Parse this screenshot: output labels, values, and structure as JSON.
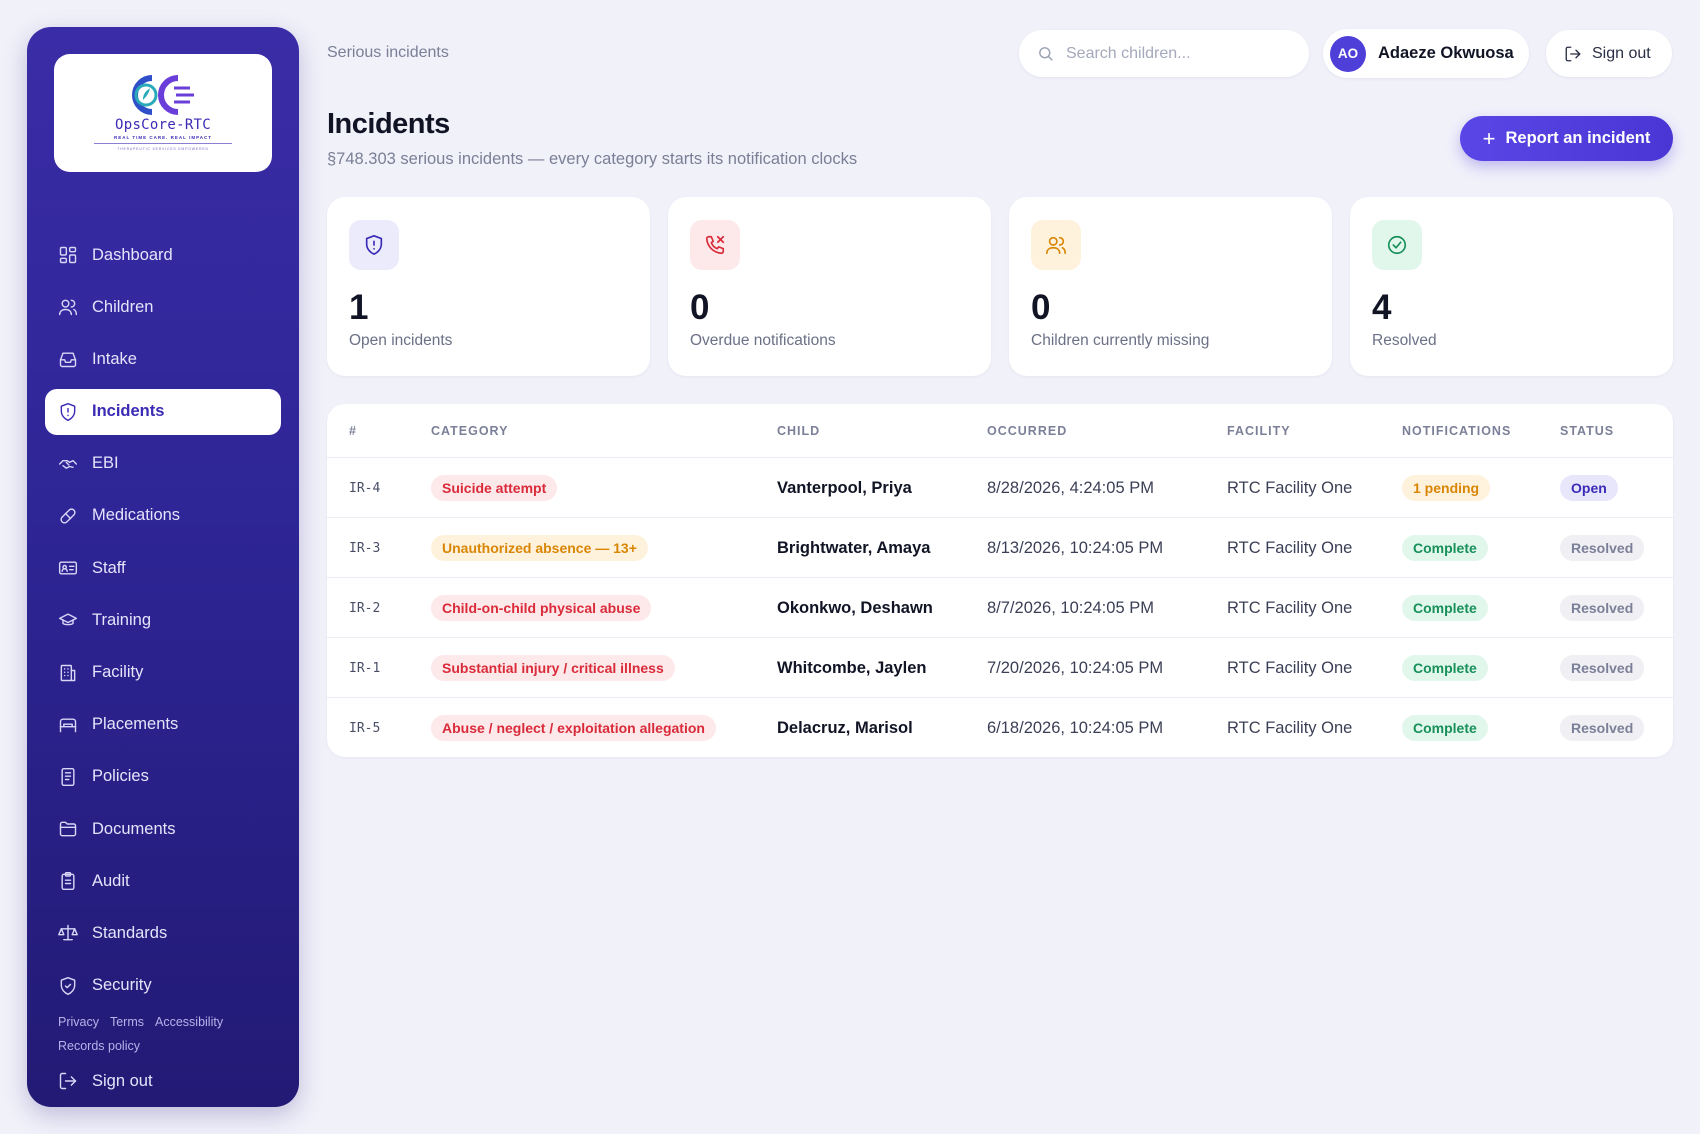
{
  "brand": {
    "name": "OpsCore-RTC",
    "tagline": "REAL TIME CARE. REAL IMPACT",
    "footline": "THERAPEUTIC SERVICES EMPOWERED"
  },
  "sidebar": {
    "items": [
      {
        "label": "Dashboard",
        "icon": "dashboard-icon"
      },
      {
        "label": "Children",
        "icon": "children-icon"
      },
      {
        "label": "Intake",
        "icon": "inbox-icon"
      },
      {
        "label": "Incidents",
        "icon": "shield-alert-icon",
        "active": true
      },
      {
        "label": "EBI",
        "icon": "handshake-icon"
      },
      {
        "label": "Medications",
        "icon": "pill-icon"
      },
      {
        "label": "Staff",
        "icon": "id-card-icon"
      },
      {
        "label": "Training",
        "icon": "graduation-cap-icon"
      },
      {
        "label": "Facility",
        "icon": "building-icon"
      },
      {
        "label": "Placements",
        "icon": "bed-icon"
      },
      {
        "label": "Policies",
        "icon": "document-icon"
      },
      {
        "label": "Documents",
        "icon": "folder-icon"
      },
      {
        "label": "Audit",
        "icon": "clipboard-icon"
      },
      {
        "label": "Standards",
        "icon": "scale-icon"
      },
      {
        "label": "Security",
        "icon": "shield-check-icon"
      }
    ],
    "footer_links": [
      "Privacy",
      "Terms",
      "Accessibility",
      "Records policy"
    ],
    "signout_label": "Sign out"
  },
  "header": {
    "breadcrumb": "Serious incidents",
    "search_placeholder": "Search children...",
    "user_initials": "AO",
    "user_name": "Adaeze Okwuosa",
    "signout_label": "Sign out"
  },
  "page": {
    "title": "Incidents",
    "subtitle": "§748.303 serious incidents — every category starts its notification clocks",
    "report_button": "Report an incident"
  },
  "stats": [
    {
      "value": "1",
      "label": "Open incidents",
      "icon": "shield-alert-icon",
      "bg": "#ecebfb",
      "color": "#3b2bb5"
    },
    {
      "value": "0",
      "label": "Overdue notifications",
      "icon": "phone-alert-icon",
      "bg": "#fde8ea",
      "color": "#d92b3a"
    },
    {
      "value": "0",
      "label": "Children currently missing",
      "icon": "people-icon",
      "bg": "#fff2dc",
      "color": "#d98606"
    },
    {
      "value": "4",
      "label": "Resolved",
      "icon": "check-circle-icon",
      "bg": "#e2f7ec",
      "color": "#17905a"
    }
  ],
  "table": {
    "columns": [
      "#",
      "CATEGORY",
      "CHILD",
      "OCCURRED",
      "FACILITY",
      "NOTIFICATIONS",
      "STATUS"
    ],
    "rows": [
      {
        "id": "IR-4",
        "category": "Suicide attempt",
        "category_tone": "red",
        "child": "Vanterpool, Priya",
        "occurred": "8/28/2026, 4:24:05 PM",
        "facility": "RTC Facility One",
        "notifications": "1 pending",
        "notifications_tone": "amber",
        "status": "Open",
        "status_tone": "indigo"
      },
      {
        "id": "IR-3",
        "category": "Unauthorized absence — 13+",
        "category_tone": "amber",
        "child": "Brightwater, Amaya",
        "occurred": "8/13/2026, 10:24:05 PM",
        "facility": "RTC Facility One",
        "notifications": "Complete",
        "notifications_tone": "green",
        "status": "Resolved",
        "status_tone": "gray"
      },
      {
        "id": "IR-2",
        "category": "Child-on-child physical abuse",
        "category_tone": "red",
        "child": "Okonkwo, Deshawn",
        "occurred": "8/7/2026, 10:24:05 PM",
        "facility": "RTC Facility One",
        "notifications": "Complete",
        "notifications_tone": "green",
        "status": "Resolved",
        "status_tone": "gray"
      },
      {
        "id": "IR-1",
        "category": "Substantial injury / critical illness",
        "category_tone": "red",
        "child": "Whitcombe, Jaylen",
        "occurred": "7/20/2026, 10:24:05 PM",
        "facility": "RTC Facility One",
        "notifications": "Complete",
        "notifications_tone": "green",
        "status": "Resolved",
        "status_tone": "gray"
      },
      {
        "id": "IR-5",
        "category": "Abuse / neglect / exploitation allegation",
        "category_tone": "red",
        "child": "Delacruz, Marisol",
        "occurred": "6/18/2026, 10:24:05 PM",
        "facility": "RTC Facility One",
        "notifications": "Complete",
        "notifications_tone": "green",
        "status": "Resolved",
        "status_tone": "gray"
      }
    ]
  }
}
